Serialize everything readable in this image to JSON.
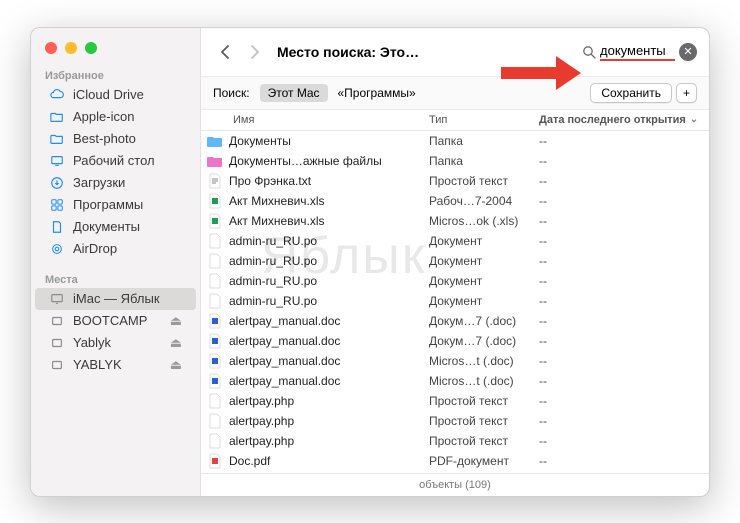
{
  "window": {
    "title": "Место поиска: Это…"
  },
  "search": {
    "value": "документы"
  },
  "scope": {
    "label": "Поиск:",
    "scope1": "Этот Mac",
    "scope2": "«Программы»",
    "save": "Сохранить",
    "plus": "+"
  },
  "columns": {
    "name": "Имя",
    "type": "Тип",
    "date": "Дата последнего открытия"
  },
  "sidebar": {
    "favorites_label": "Избранное",
    "places_label": "Места",
    "favorites": [
      {
        "label": "iCloud Drive",
        "icon": "cloud"
      },
      {
        "label": "Apple-icon",
        "icon": "folder"
      },
      {
        "label": "Best-photo",
        "icon": "folder"
      },
      {
        "label": "Рабочий стол",
        "icon": "desktop"
      },
      {
        "label": "Загрузки",
        "icon": "download"
      },
      {
        "label": "Программы",
        "icon": "apps"
      },
      {
        "label": "Документы",
        "icon": "doc"
      },
      {
        "label": "AirDrop",
        "icon": "airdrop"
      }
    ],
    "places": [
      {
        "label": "iMac — Яблык",
        "icon": "imac",
        "selected": true
      },
      {
        "label": "BOOTCAMP",
        "icon": "disk",
        "eject": true
      },
      {
        "label": "Yablyk",
        "icon": "disk",
        "eject": true
      },
      {
        "label": "YABLYK",
        "icon": "disk",
        "eject": true
      }
    ]
  },
  "rows": [
    {
      "icon": "folder-blue",
      "name": "Документы",
      "type": "Папка",
      "date": "--"
    },
    {
      "icon": "folder-pink",
      "name": "Документы…ажные файлы",
      "type": "Папка",
      "date": "--"
    },
    {
      "icon": "txt",
      "name": "Про Фрэнка.txt",
      "type": "Простой текст",
      "date": "--"
    },
    {
      "icon": "xls",
      "name": "Акт Михневич.xls",
      "type": "Рабоч…7-2004",
      "date": "--"
    },
    {
      "icon": "xls",
      "name": "Акт Михневич.xls",
      "type": "Micros…ok (.xls)",
      "date": "--"
    },
    {
      "icon": "blank",
      "name": "admin-ru_RU.po",
      "type": "Документ",
      "date": "--"
    },
    {
      "icon": "blank",
      "name": "admin-ru_RU.po",
      "type": "Документ",
      "date": "--"
    },
    {
      "icon": "blank",
      "name": "admin-ru_RU.po",
      "type": "Документ",
      "date": "--"
    },
    {
      "icon": "blank",
      "name": "admin-ru_RU.po",
      "type": "Документ",
      "date": "--"
    },
    {
      "icon": "doc",
      "name": "alertpay_manual.doc",
      "type": "Докум…7 (.doc)",
      "date": "--"
    },
    {
      "icon": "doc",
      "name": "alertpay_manual.doc",
      "type": "Докум…7 (.doc)",
      "date": "--"
    },
    {
      "icon": "doc",
      "name": "alertpay_manual.doc",
      "type": "Micros…t (.doc)",
      "date": "--"
    },
    {
      "icon": "doc",
      "name": "alertpay_manual.doc",
      "type": "Micros…t (.doc)",
      "date": "--"
    },
    {
      "icon": "blank",
      "name": "alertpay.php",
      "type": "Простой текст",
      "date": "--"
    },
    {
      "icon": "blank",
      "name": "alertpay.php",
      "type": "Простой текст",
      "date": "--"
    },
    {
      "icon": "blank",
      "name": "alertpay.php",
      "type": "Простой текст",
      "date": "--"
    },
    {
      "icon": "pdf",
      "name": "Doc.pdf",
      "type": "PDF-документ",
      "date": "--"
    }
  ],
  "status": "объекты (109)",
  "watermark": "Яблык"
}
